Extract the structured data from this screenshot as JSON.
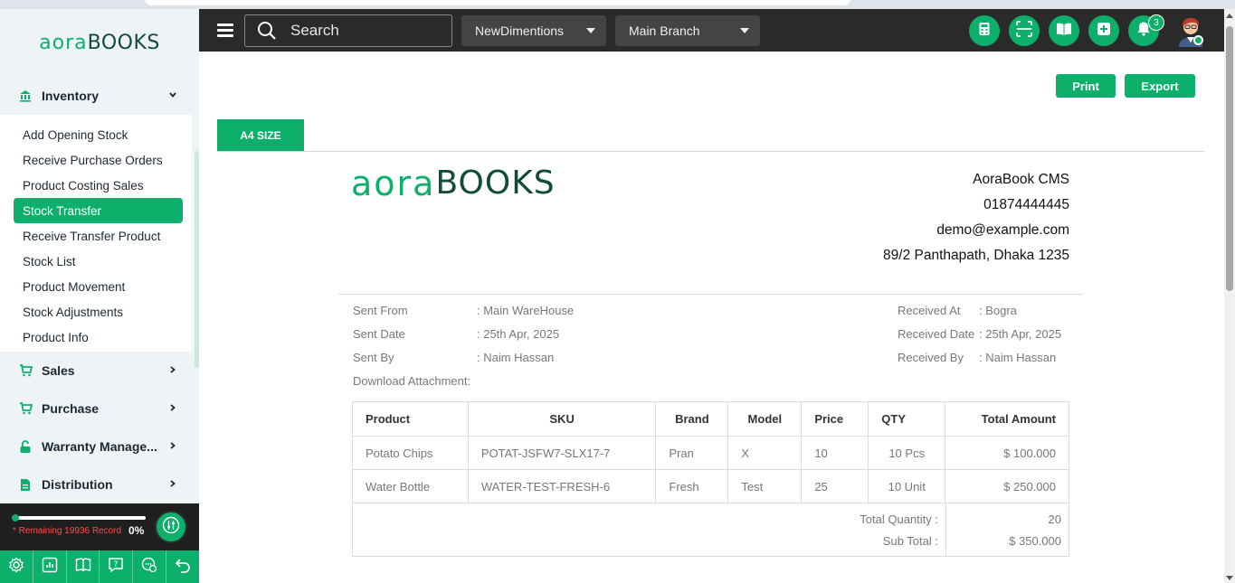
{
  "sidebar": {
    "brand_left": "aora",
    "brand_right": "BOOKS",
    "inventory": {
      "label": "Inventory",
      "items": [
        {
          "label": "Add Opening Stock"
        },
        {
          "label": "Receive Purchase Orders"
        },
        {
          "label": "Product Costing Sales"
        },
        {
          "label": "Stock Transfer"
        },
        {
          "label": "Receive Transfer Product"
        },
        {
          "label": "Stock List"
        },
        {
          "label": "Product Movement"
        },
        {
          "label": "Stock Adjustments"
        },
        {
          "label": "Product Info"
        }
      ],
      "active_item": "Stock Transfer"
    },
    "sections": [
      {
        "label": "Sales",
        "icon": "cart-icon"
      },
      {
        "label": "Purchase",
        "icon": "cart-icon"
      },
      {
        "label": "Warranty Manage...",
        "icon": "unlock-icon"
      },
      {
        "label": "Distribution",
        "icon": "document-icon"
      }
    ],
    "storage": {
      "remaining_text": "* Remaining 19936 Record",
      "percent_text": "0%",
      "used_fraction": 0.0
    },
    "bottom_icons": [
      "settings-icon",
      "chart-icon",
      "book-icon",
      "help-icon",
      "chat-icon",
      "back-icon"
    ]
  },
  "topbar": {
    "search_placeholder": "Search",
    "company_select": "NewDimentions",
    "branch_select": "Main Branch",
    "notification_count": "3",
    "buttons": [
      "calculator-icon",
      "scan-icon",
      "book-open-icon",
      "plus-square-icon",
      "bell-icon"
    ]
  },
  "actions": {
    "print": "Print",
    "export": "Export"
  },
  "tab": {
    "label": "A4 SIZE"
  },
  "document": {
    "logo_left": "aora",
    "logo_right": "BOOKS",
    "company": {
      "name": "AoraBook CMS",
      "phone": "01874444445",
      "email": "demo@example.com",
      "address": "89/2 Panthapath, Dhaka 1235"
    },
    "left_meta": [
      {
        "label": "Sent From",
        "value": ": Main WareHouse"
      },
      {
        "label": "Sent Date",
        "value": ": 25th Apr, 2025"
      },
      {
        "label": "Sent By",
        "value": ": Naim Hassan"
      },
      {
        "label": "Download Attachment",
        "value": ":"
      }
    ],
    "right_meta": [
      {
        "label": "Received At",
        "value": ": Bogra"
      },
      {
        "label": "Received Date",
        "value": ": 25th Apr, 2025"
      },
      {
        "label": "Received By",
        "value": ": Naim Hassan"
      }
    ],
    "table": {
      "headers": [
        "Product",
        "SKU",
        "Brand",
        "Model",
        "Price",
        "QTY",
        "Total Amount"
      ],
      "rows": [
        [
          "Potato Chips",
          "POTAT-JSFW7-SLX17-7",
          "Pran",
          "X",
          "10",
          "10 Pcs",
          "$ 100.000"
        ],
        [
          "Water Bottle",
          "WATER-TEST-FRESH-6",
          "Fresh",
          "Test",
          "25",
          "10 Unit",
          "$ 250.000"
        ]
      ]
    },
    "totals": {
      "quantity_label": "Total Quantity :",
      "quantity_value": "20",
      "subtotal_label": "Sub Total :",
      "subtotal_value": "$ 350.000"
    }
  },
  "colors": {
    "accent": "#0cb06b",
    "topbar": "#2a2a2a",
    "sidebar_bg": "#eef3f6"
  }
}
